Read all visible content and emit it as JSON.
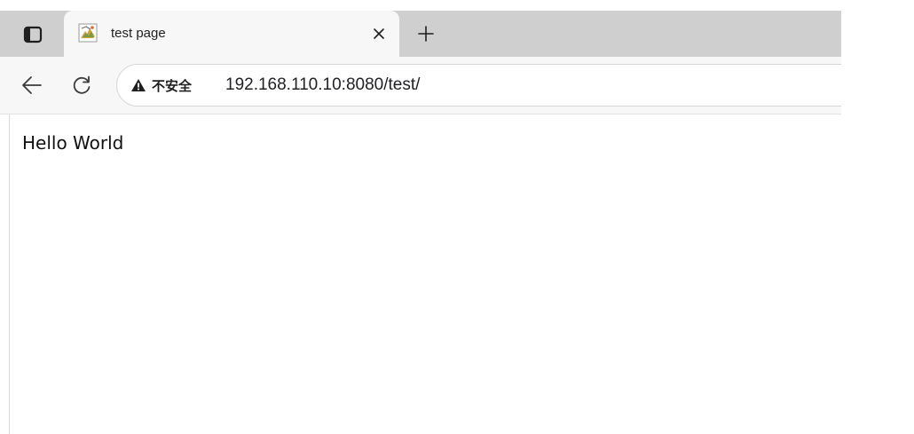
{
  "browser": {
    "tab": {
      "title": "test page",
      "favicon": "tomcat-cat-icon"
    },
    "omnibox": {
      "security_label": "不安全",
      "url": "192.168.110.10:8080/test/"
    },
    "icons": {
      "tab_actions": "tab-actions-icon",
      "close": "close-icon",
      "new_tab": "plus-icon",
      "back": "arrow-left-icon",
      "reload": "reload-icon",
      "warning": "warning-triangle-icon"
    },
    "colors": {
      "tabstrip": "#cfcfcf",
      "active_tab": "#f7f7f7",
      "toolbar": "#f7f7f7"
    }
  },
  "page": {
    "body_text": "Hello World"
  }
}
